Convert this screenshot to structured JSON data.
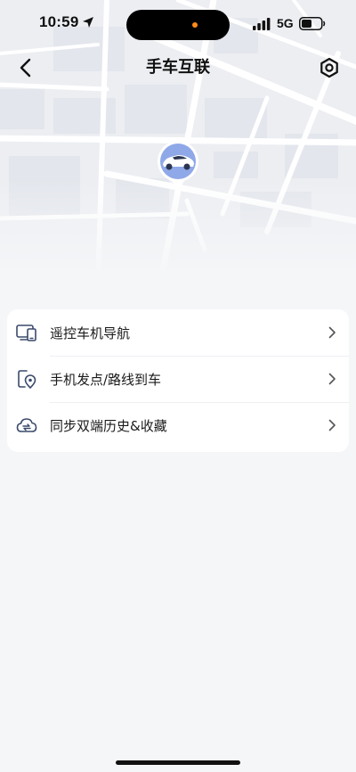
{
  "status_bar": {
    "time": "10:59",
    "network": "5G"
  },
  "nav": {
    "title": "手车互联",
    "back_icon": "chevron-left-icon",
    "settings_icon": "settings-icon"
  },
  "menu": {
    "items": [
      {
        "label": "遥控车机导航",
        "icon": "phone-car-screen-icon"
      },
      {
        "label": "手机发点/路线到车",
        "icon": "phone-location-icon"
      },
      {
        "label": "同步双端历史&收藏",
        "icon": "cloud-sync-icon"
      }
    ]
  },
  "colors": {
    "background": "#f5f6f8",
    "card": "#ffffff",
    "marker_ring": "#8fa8e8",
    "accent_dot": "#ff8c1a"
  }
}
